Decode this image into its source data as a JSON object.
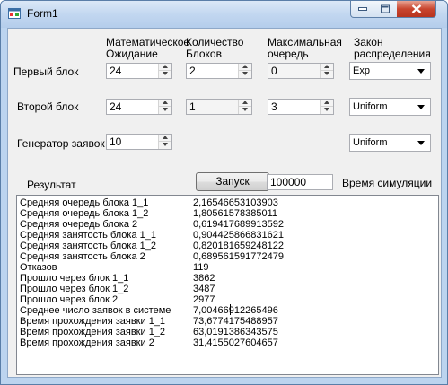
{
  "window": {
    "title": "Form1"
  },
  "headers": {
    "expectation": [
      "Математическое",
      "Ожидание"
    ],
    "blocks": [
      "Количество",
      "Блоков"
    ],
    "max_queue": [
      "Максимальная",
      "очередь"
    ],
    "distribution": [
      "Закон",
      "распределения"
    ]
  },
  "rows": [
    {
      "label": "Первый блок",
      "expectation": "24",
      "blocks": "2",
      "max_queue": "0",
      "distribution": "Exp"
    },
    {
      "label": "Второй блок",
      "expectation": "24",
      "blocks": "1",
      "max_queue": "3",
      "distribution": "Uniform"
    }
  ],
  "generator": {
    "label": "Генератор заявок",
    "value": "10",
    "distribution": "Uniform"
  },
  "result_label": "Результат",
  "start_button": "Запуск",
  "simulation": {
    "value": "100000",
    "label": "Время симуляции"
  },
  "results": [
    {
      "k": "Средняя очередь блока 1_1",
      "v": "2,16546653103903"
    },
    {
      "k": "Средняя очередь блока 1_2",
      "v": "1,80561578385011"
    },
    {
      "k": "Средняя очередь блока 2",
      "v": "0,619417689913592"
    },
    {
      "k": "Средняя занятость блока 1_1",
      "v": "0,904425866831621"
    },
    {
      "k": "Средняя занятость блока 1_2",
      "v": "0,820181659248122"
    },
    {
      "k": "Средняя занятость блока 2",
      "v": "0,689561591772479"
    },
    {
      "k": "Отказов",
      "v": "119"
    },
    {
      "k": "Прошло через блок 1_1",
      "v": "3862"
    },
    {
      "k": "Прошло через блок 1_2",
      "v": "3487"
    },
    {
      "k": "Прошло через блок 2",
      "v": "2977"
    },
    {
      "k": "Среднее число заявок в системе",
      "v": "7,00466912265496"
    },
    {
      "k": "Время прохождения заявки 1_1",
      "v": "73,6774175488957"
    },
    {
      "k": "Время прохождения заявки 1_2",
      "v": "63,0191386343575"
    },
    {
      "k": "Время прохождения заявки 2",
      "v": "31,4155027604657"
    }
  ]
}
